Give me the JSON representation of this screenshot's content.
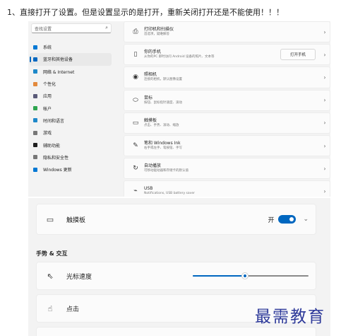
{
  "caption": "1、直接打开了设置。但是设置显示的是打开，重新关闭打开还是不能使用！！！",
  "search": {
    "placeholder": "查找设置"
  },
  "nav": [
    {
      "label": "系统",
      "icon": "monitor-icon",
      "color": "#0078d4"
    },
    {
      "label": "蓝牙和其他设备",
      "icon": "bluetooth-icon",
      "color": "#0067c0",
      "active": true
    },
    {
      "label": "网络 & Internet",
      "icon": "wifi-icon",
      "color": "#1e88c9"
    },
    {
      "label": "个性化",
      "icon": "brush-icon",
      "color": "#e38a3d"
    },
    {
      "label": "应用",
      "icon": "apps-icon",
      "color": "#5a5a78"
    },
    {
      "label": "帐户",
      "icon": "person-icon",
      "color": "#2da44e"
    },
    {
      "label": "时间和语言",
      "icon": "globe-clock-icon",
      "color": "#1e88c9"
    },
    {
      "label": "游戏",
      "icon": "gamepad-icon",
      "color": "#777777"
    },
    {
      "label": "辅助功能",
      "icon": "accessibility-icon",
      "color": "#1f1f1f"
    },
    {
      "label": "隐私和安全性",
      "icon": "shield-icon",
      "color": "#777777"
    },
    {
      "label": "Windows 更新",
      "icon": "update-icon",
      "color": "#0078d4"
    }
  ],
  "devices": [
    {
      "title": "打印机和扫描仪",
      "sub": "首选项，疑难解答",
      "icon": "printer-icon",
      "glyph": "⎙"
    },
    {
      "title": "你的手机",
      "sub": "从你的PC 即时访问 Android 设备的照片、文本等",
      "icon": "phone-icon",
      "glyph": "▯",
      "button": "打开手机"
    },
    {
      "title": "照相机",
      "sub": "连接的相机，默认图像设置",
      "icon": "camera-icon",
      "glyph": "◉"
    },
    {
      "title": "鼠标",
      "sub": "按钮、鼠标指针速度、滚动",
      "icon": "mouse-icon",
      "glyph": "⬭"
    },
    {
      "title": "触摸板",
      "sub": "点击、手势、滚动、缩放",
      "icon": "touchpad-icon",
      "glyph": "▭"
    },
    {
      "title": "笔和 Windows Ink",
      "sub": "右手或左手、笔按钮、手写",
      "icon": "pen-icon",
      "glyph": "✎"
    },
    {
      "title": "自动播放",
      "sub": "可移动驱动器和存储卡的默认值",
      "icon": "autoplay-icon",
      "glyph": "↻"
    },
    {
      "title": "USB",
      "sub": "Notifications, USB battery saver",
      "icon": "usb-icon",
      "glyph": "⌁"
    }
  ],
  "touchpad": {
    "label": "触摸板",
    "state": "开",
    "enabled": true
  },
  "gestures": {
    "heading": "手势 & 交互",
    "cursor_speed": {
      "label": "光标速度",
      "value": 0.45
    },
    "tap": {
      "label": "点击"
    }
  },
  "watermark": "最需教育",
  "colors": {
    "accent": "#0067c0",
    "watermark": "#2e3a9a"
  }
}
